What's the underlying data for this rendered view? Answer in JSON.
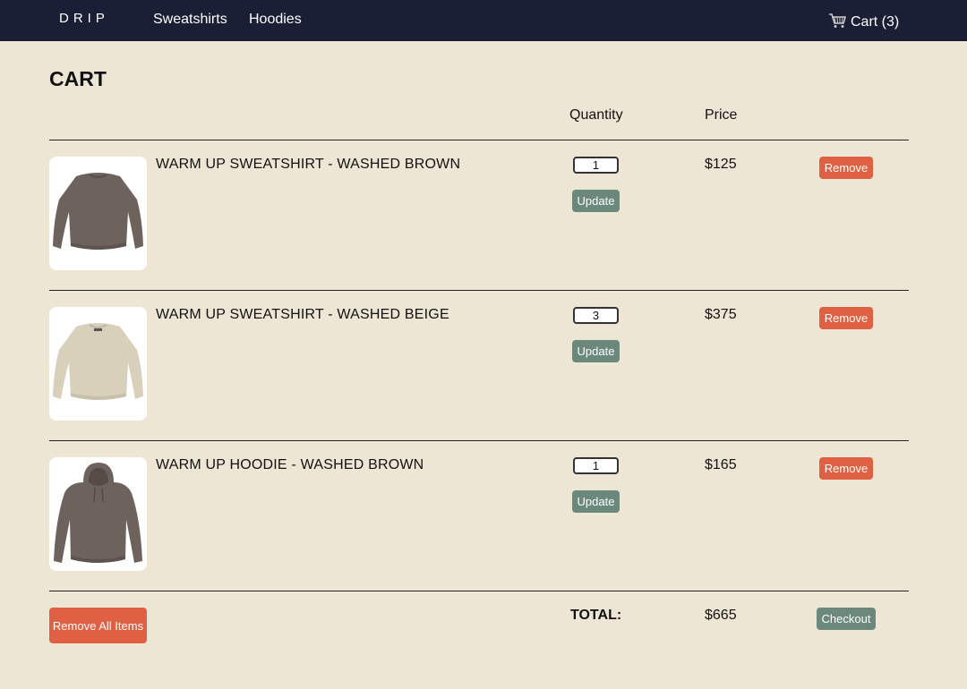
{
  "nav": {
    "brand": "DRIP",
    "links": [
      "Sweatshirts",
      "Hoodies"
    ],
    "cart_label": "Cart (3)",
    "cart_icon": "shopping-cart-icon"
  },
  "cart": {
    "title": "CART",
    "columns": {
      "quantity": "Quantity",
      "price": "Price"
    },
    "items": [
      {
        "name": "WARM UP SWEATSHIRT - WASHED BROWN",
        "quantity": "1",
        "price": "$125",
        "update_label": "Update",
        "remove_label": "Remove",
        "image_color": "#6e625c"
      },
      {
        "name": "WARM UP SWEATSHIRT - WASHED BEIGE",
        "quantity": "3",
        "price": "$375",
        "update_label": "Update",
        "remove_label": "Remove",
        "image_color": "#d8d0bb"
      },
      {
        "name": "WARM UP HOODIE - WASHED BROWN",
        "quantity": "1",
        "price": "$165",
        "update_label": "Update",
        "remove_label": "Remove",
        "image_color": "#6e625c"
      }
    ],
    "footer": {
      "remove_all_label": "Remove All Items",
      "total_label": "TOTAL:",
      "total_value": "$665",
      "checkout_label": "Checkout"
    }
  },
  "colors": {
    "background": "#eee6d5",
    "navbar": "#1b1f35",
    "remove": "#e06043",
    "update": "#6b887c"
  }
}
